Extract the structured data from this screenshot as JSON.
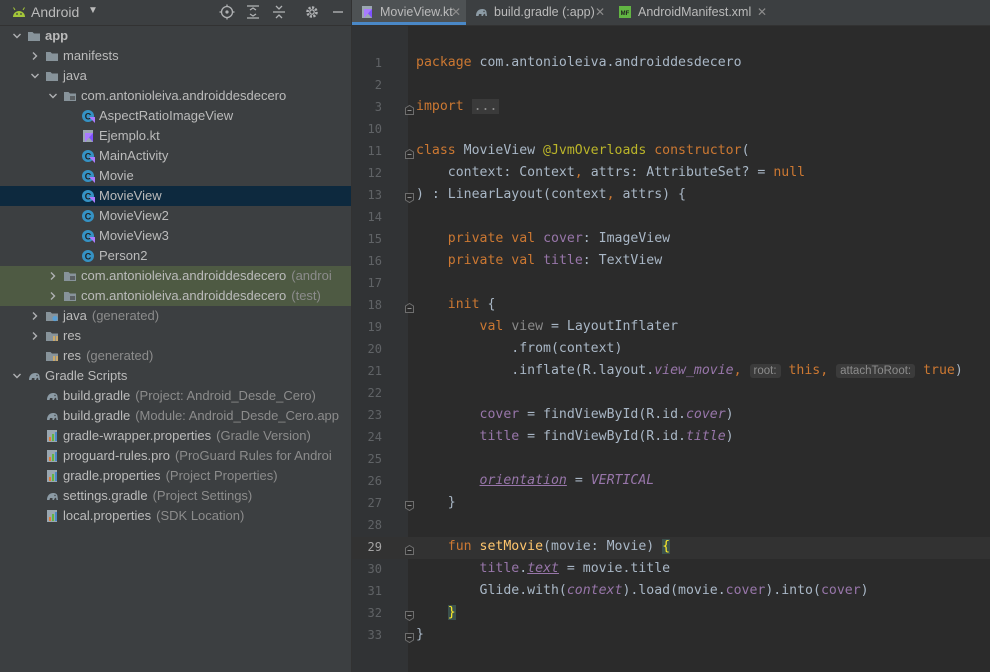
{
  "project": {
    "view_title": "Android",
    "tree": [
      {
        "label": "app",
        "suffix": "",
        "depth": 0,
        "expanded": true,
        "icon": "folder-icon",
        "bold": true
      },
      {
        "label": "manifests",
        "suffix": "",
        "depth": 1,
        "expanded": false,
        "icon": "folder-icon"
      },
      {
        "label": "java",
        "suffix": "",
        "depth": 1,
        "expanded": true,
        "icon": "folder-icon"
      },
      {
        "label": "com.antonioleiva.androiddesdecero",
        "suffix": "",
        "depth": 2,
        "expanded": true,
        "icon": "package-icon"
      },
      {
        "label": "AspectRatioImageView",
        "suffix": "",
        "depth": 3,
        "icon": "kotlin-class-icon"
      },
      {
        "label": "Ejemplo.kt",
        "suffix": "",
        "depth": 3,
        "icon": "kotlin-file-icon"
      },
      {
        "label": "MainActivity",
        "suffix": "",
        "depth": 3,
        "icon": "kotlin-class-icon"
      },
      {
        "label": "Movie",
        "suffix": "",
        "depth": 3,
        "icon": "kotlin-class-icon"
      },
      {
        "label": "MovieView",
        "suffix": "",
        "depth": 3,
        "icon": "kotlin-class-icon",
        "selected": true
      },
      {
        "label": "MovieView2",
        "suffix": "",
        "depth": 3,
        "icon": "java-class-icon"
      },
      {
        "label": "MovieView3",
        "suffix": "",
        "depth": 3,
        "icon": "kotlin-class-icon"
      },
      {
        "label": "Person2",
        "suffix": "",
        "depth": 3,
        "icon": "java-class-icon"
      },
      {
        "label": "com.antonioleiva.androiddesdecero",
        "suffix": "(androi",
        "depth": 2,
        "expanded": false,
        "icon": "package-icon",
        "shaded": true
      },
      {
        "label": "com.antonioleiva.androiddesdecero",
        "suffix": "(test)",
        "depth": 2,
        "expanded": false,
        "icon": "package-icon",
        "shaded": true
      },
      {
        "label": "java",
        "suffix": "(generated)",
        "depth": 1,
        "expanded": false,
        "icon": "generated-folder-icon"
      },
      {
        "label": "res",
        "suffix": "",
        "depth": 1,
        "expanded": false,
        "icon": "res-folder-icon"
      },
      {
        "label": "res",
        "suffix": "(generated)",
        "depth": 1,
        "expanded": null,
        "icon": "res-folder-icon"
      },
      {
        "label": "Gradle Scripts",
        "suffix": "",
        "depth": 0,
        "expanded": true,
        "icon": "gradle-icon"
      },
      {
        "label": "build.gradle",
        "suffix": "(Project: Android_Desde_Cero)",
        "depth": 1,
        "icon": "gradle-icon"
      },
      {
        "label": "build.gradle",
        "suffix": "(Module: Android_Desde_Cero.app",
        "depth": 1,
        "icon": "gradle-icon"
      },
      {
        "label": "gradle-wrapper.properties",
        "suffix": "(Gradle Version)",
        "depth": 1,
        "icon": "properties-icon"
      },
      {
        "label": "proguard-rules.pro",
        "suffix": "(ProGuard Rules for Androi",
        "depth": 1,
        "icon": "properties-icon"
      },
      {
        "label": "gradle.properties",
        "suffix": "(Project Properties)",
        "depth": 1,
        "icon": "properties-icon"
      },
      {
        "label": "settings.gradle",
        "suffix": "(Project Settings)",
        "depth": 1,
        "icon": "gradle-icon"
      },
      {
        "label": "local.properties",
        "suffix": "(SDK Location)",
        "depth": 1,
        "icon": "properties-icon"
      }
    ]
  },
  "tabs": [
    {
      "label": "MovieView.kt",
      "icon": "kotlin-file-icon",
      "active": true
    },
    {
      "label": "build.gradle (:app)",
      "icon": "gradle-icon",
      "active": false
    },
    {
      "label": "AndroidManifest.xml",
      "icon": "manifest-icon",
      "active": false
    }
  ],
  "editor": {
    "lines": [
      {
        "n": "1",
        "t": "package com.antonioleiva.androiddesdecero"
      },
      {
        "n": "2",
        "t": ""
      },
      {
        "n": "3",
        "t": "import ..."
      },
      {
        "n": "10",
        "t": ""
      },
      {
        "n": "11",
        "t": "class MovieView @JvmOverloads constructor("
      },
      {
        "n": "12",
        "t": "    context: Context, attrs: AttributeSet? = null"
      },
      {
        "n": "13",
        "t": ") : LinearLayout(context, attrs) {"
      },
      {
        "n": "14",
        "t": ""
      },
      {
        "n": "15",
        "t": "    private val cover: ImageView"
      },
      {
        "n": "16",
        "t": "    private val title: TextView"
      },
      {
        "n": "17",
        "t": ""
      },
      {
        "n": "18",
        "t": "    init {"
      },
      {
        "n": "19",
        "t": "        val view = LayoutInflater"
      },
      {
        "n": "20",
        "t": "            .from(context)"
      },
      {
        "n": "21",
        "t": "            .inflate(R.layout.view_movie, root: this, attachToRoot: true)"
      },
      {
        "n": "22",
        "t": ""
      },
      {
        "n": "23",
        "t": "        cover = findViewById(R.id.cover)"
      },
      {
        "n": "24",
        "t": "        title = findViewById(R.id.title)"
      },
      {
        "n": "25",
        "t": ""
      },
      {
        "n": "26",
        "t": "        orientation = VERTICAL"
      },
      {
        "n": "27",
        "t": "    }"
      },
      {
        "n": "28",
        "t": ""
      },
      {
        "n": "29",
        "t": "    fun setMovie(movie: Movie) {"
      },
      {
        "n": "30",
        "t": "        title.text = movie.title"
      },
      {
        "n": "31",
        "t": "        Glide.with(context).load(movie.cover).into(cover)"
      },
      {
        "n": "32",
        "t": "    }"
      },
      {
        "n": "33",
        "t": "}"
      }
    ]
  }
}
